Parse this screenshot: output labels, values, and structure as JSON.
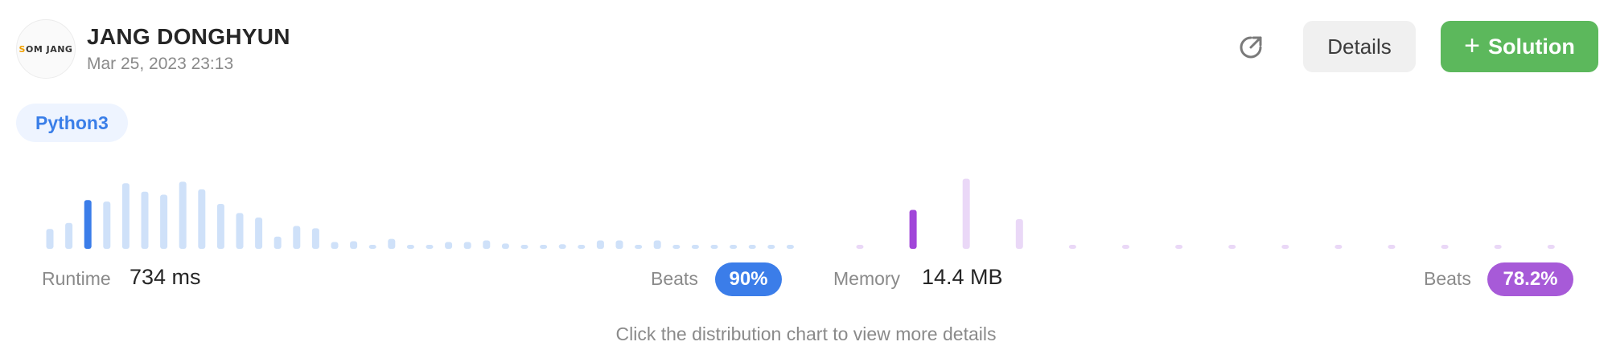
{
  "user": {
    "name": "JANG DONGHYUN",
    "timestamp": "Mar 25, 2023 23:13",
    "avatar_text_a": "S",
    "avatar_text_b": "OM JANG"
  },
  "actions": {
    "share_icon": "share-icon",
    "details_label": "Details",
    "solution_plus": "+",
    "solution_label": "Solution"
  },
  "language": "Python3",
  "runtime": {
    "label": "Runtime",
    "value": "734 ms",
    "beats_label": "Beats",
    "beats_value": "90%"
  },
  "memory": {
    "label": "Memory",
    "value": "14.4 MB",
    "beats_label": "Beats",
    "beats_value": "78.2%"
  },
  "hint": "Click the distribution chart to view more details",
  "colors": {
    "runtime_bar": "#cfe1f9",
    "runtime_highlight": "#3b7de9",
    "memory_bar": "#ead8f7",
    "memory_highlight": "#a146d9",
    "beats_runtime_badge": "#3b7de9",
    "beats_memory_badge": "#a75ad8",
    "solution_button": "#5cb85c"
  },
  "chart_data": [
    {
      "type": "bar",
      "name": "runtime-distribution",
      "values": [
        26,
        34,
        64,
        62,
        86,
        75,
        71,
        88,
        78,
        59,
        47,
        41,
        16,
        30,
        27,
        9,
        10,
        5,
        13,
        5,
        5,
        9,
        9,
        11,
        7,
        5,
        5,
        6,
        5,
        11,
        11,
        5,
        11,
        5,
        5,
        5,
        5,
        5,
        5,
        5
      ],
      "highlight_index": 2
    },
    {
      "type": "bar",
      "name": "memory-distribution",
      "values": [
        5,
        51,
        92,
        39,
        5,
        5,
        5,
        5,
        5,
        5,
        5,
        5,
        5,
        5
      ],
      "highlight_index": 1
    }
  ]
}
